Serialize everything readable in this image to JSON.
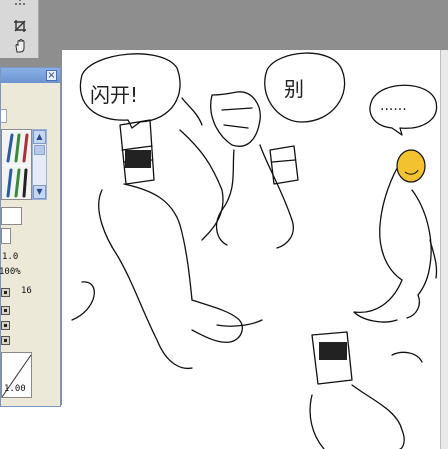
{
  "panel": {
    "close_glyph": "×",
    "values": {
      "value_a": "1.0",
      "value_b": "100%",
      "brush_size": "16",
      "curve_end": "1.00"
    }
  },
  "toolbox": {
    "tools": [
      "grid-dots-icon",
      "crop-icon",
      "hand-icon"
    ]
  },
  "canvas": {
    "speech_bubble_left": "闪开!",
    "speech_bubble_right": "别",
    "speech_bubble_dots": "......"
  },
  "colors": {
    "workspace": "#8e8e8e",
    "canvas": "#ffffff",
    "panel_bg": "#ece9d8",
    "titlebar": "#7a9fdc",
    "highlight": "#f2c230"
  }
}
